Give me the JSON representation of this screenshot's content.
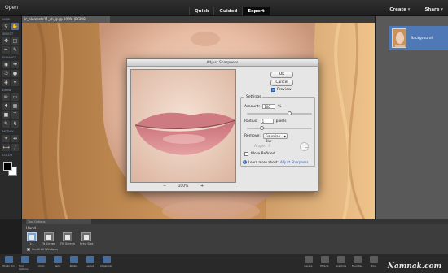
{
  "menubar": {
    "open_label": "Open",
    "modes": [
      "Quick",
      "Guided",
      "Expert"
    ],
    "active_mode": "Expert",
    "create_label": "Create",
    "share_label": "Share"
  },
  "document": {
    "tab_title": "lc_elements11_ch_ip @ 100% (RGB/8)"
  },
  "toolbox": {
    "groups": [
      "VIEW",
      "SELECT",
      "ENHANCE",
      "DRAW",
      "MODIFY",
      "COLOR"
    ]
  },
  "layers": {
    "layer_name": "Background"
  },
  "dialog": {
    "title": "Adjust Sharpness",
    "ok_label": "OK",
    "cancel_label": "Cancel",
    "preview_label": "Preview",
    "settings_label": "Settings",
    "amount_label": "Amount:",
    "amount_value": "100",
    "amount_unit": "%",
    "radius_label": "Radius:",
    "radius_value": "1",
    "radius_unit": "pixels",
    "remove_label": "Remove:",
    "remove_value": "Gaussian Blur",
    "angle_label": "Angle:",
    "angle_value": "0",
    "more_refined_label": "More Refined",
    "learn_more_prefix": "Learn more about:",
    "learn_more_link": "Adjust Sharpness",
    "zoom_value": "100%"
  },
  "bottom_panel": {
    "header_tab": "Tool Options",
    "section_label": "Hand",
    "presets": [
      "1:1",
      "Fit Screen",
      "Fill Screen",
      "Print Size"
    ],
    "scroll_all_label": "Scroll All Windows"
  },
  "bottom_bar": {
    "left_items": [
      "Photo Bin",
      "Tool Options",
      "Undo",
      "Redo",
      "Rotate",
      "Layout",
      "Organizer"
    ],
    "right_items": [
      "Layers",
      "Effects",
      "Graphics",
      "Favorites",
      "More"
    ]
  },
  "watermark": "Namnak.com"
}
